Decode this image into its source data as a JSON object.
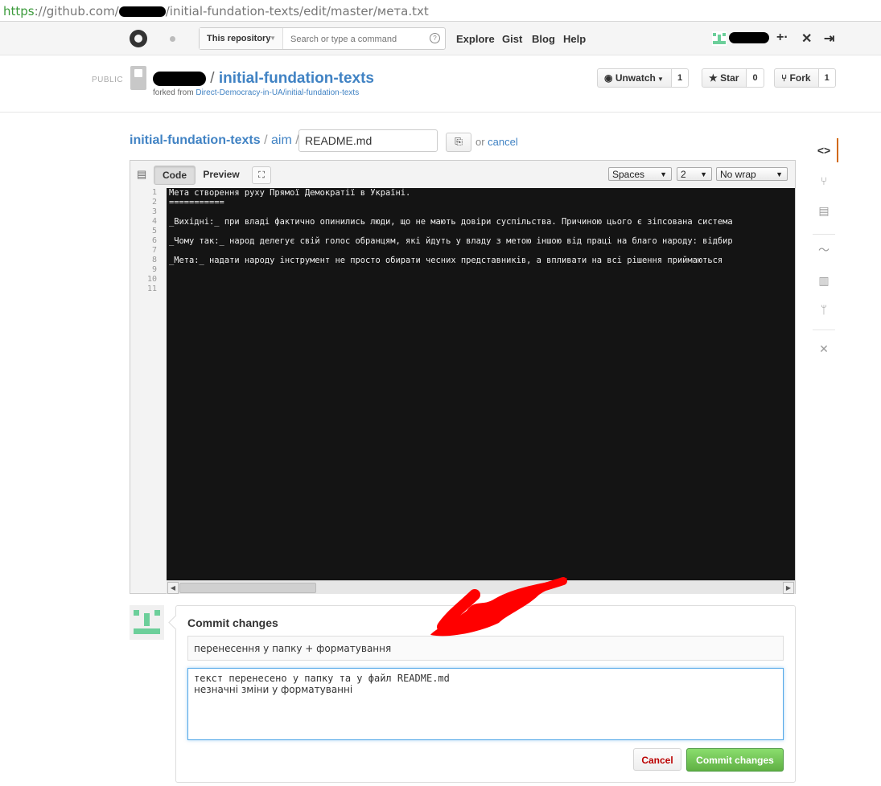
{
  "browser": {
    "url_scheme": "https",
    "url_host": "://github.com/",
    "url_path": "/initial-fundation-texts/edit/master/мета.txt"
  },
  "header": {
    "scope_label": "This repository",
    "search_placeholder": "Search or type a command",
    "search_help": "?",
    "nav": [
      "Explore",
      "Gist",
      "Blog",
      "Help"
    ],
    "plus_label": "+·"
  },
  "repo": {
    "visibility": "PUBLIC",
    "slash": "/",
    "name": "initial-fundation-texts",
    "forked_prefix": "forked from ",
    "forked_source": "Direct-Democracy-in-UA/initial-fundation-texts",
    "unwatch_label": "Unwatch",
    "unwatch_count": "1",
    "star_label": "Star",
    "star_count": "0",
    "fork_label": "Fork",
    "fork_count": "1"
  },
  "breadcrumb": {
    "repo": "initial-fundation-texts",
    "sep1": " / ",
    "dir": "aim",
    "sep2": " /",
    "filename": "README.md",
    "or_text": "or ",
    "cancel_link": "cancel"
  },
  "editor": {
    "tab_code": "Code",
    "tab_preview": "Preview",
    "indent_mode": "Spaces",
    "indent_size": "2",
    "wrap_mode": "No wrap",
    "line_numbers": [
      "1",
      "2",
      "3",
      "4",
      "5",
      "6",
      "7",
      "8",
      "9",
      "10",
      "11"
    ],
    "lines": [
      "Мета створення руху Прямої Демократії в Україні.",
      "===========",
      "",
      "_Вихідні:_ при владі фактично опинились люди, що не мають довіри суспільства. Причиною цього є зіпсована система",
      "",
      "_Чому так:_ народ делегує свій голос обранцям, які йдуть у владу з метою іншою від праці на благо народу: відбир",
      "",
      "_Мета:_ надати народу інструмент не просто обирати чесних представників, а впливати на всі рішення приймаються",
      "",
      "",
      ""
    ]
  },
  "commit": {
    "title": "Commit changes",
    "summary": "перенесення у папку + форматування",
    "description_line1": "текст перенесено у папку та у файл README.md",
    "description_line2": "незначні зміни у форматуванні",
    "cancel_label": "Cancel",
    "commit_label": "Commit changes"
  },
  "colors": {
    "link": "#4183c4",
    "commit_green": "#60b044",
    "sidebar_active": "#d26911",
    "editor_bg": "#141414"
  },
  "sidebar_icons": [
    "code-icon",
    "pull-request-icon",
    "wiki-icon",
    "pulse-icon",
    "graphs-icon",
    "network-icon",
    "settings-icon"
  ]
}
